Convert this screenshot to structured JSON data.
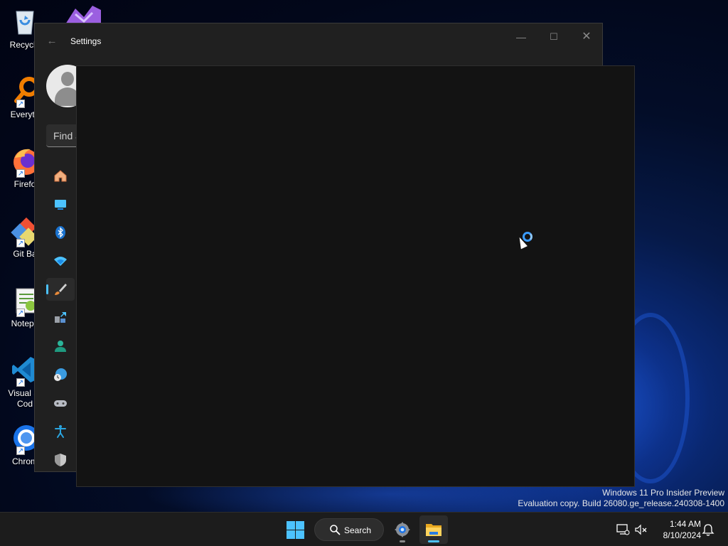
{
  "desktop": {
    "icons": [
      {
        "label": "Recycle",
        "icon": "recycle-bin-icon"
      },
      {
        "label": "Everyth",
        "icon": "everything-search-icon"
      },
      {
        "label": "Firefo",
        "icon": "firefox-icon"
      },
      {
        "label": "Git Ba",
        "icon": "git-bash-icon"
      },
      {
        "label": "Notepa",
        "icon": "notepad-plus-plus-icon"
      },
      {
        "label": "Visual St\nCod",
        "icon": "vscode-icon"
      },
      {
        "label": "Chrom",
        "icon": "chrome-icon"
      }
    ],
    "top_icon": "visual-studio-icon"
  },
  "settings_window": {
    "title": "Settings",
    "back_icon": "back-arrow-icon",
    "minimize_glyph": "—",
    "maximize_glyph": "☐",
    "close_glyph": "✕",
    "search_placeholder": "Find a setting",
    "nav_icons": [
      {
        "name": "home",
        "icon": "home-icon",
        "color": "#f0a060"
      },
      {
        "name": "system",
        "icon": "display-icon",
        "color": "#4cc2ff"
      },
      {
        "name": "bluetooth-devices",
        "icon": "bluetooth-icon",
        "color": "#1a8ce8"
      },
      {
        "name": "network-internet",
        "icon": "wifi-icon",
        "color": "#4cc2ff"
      },
      {
        "name": "personalization",
        "icon": "paintbrush-icon",
        "color": "#e88a3a",
        "selected": true
      },
      {
        "name": "apps",
        "icon": "apps-icon",
        "color": "#5aa0e0"
      },
      {
        "name": "accounts",
        "icon": "account-icon",
        "color": "#2bb59a"
      },
      {
        "name": "time-language",
        "icon": "time-language-icon",
        "color": "#3a9be0"
      },
      {
        "name": "gaming",
        "icon": "gamepad-icon",
        "color": "#b0b0b0"
      },
      {
        "name": "accessibility",
        "icon": "accessibility-icon",
        "color": "#2aa5e0"
      },
      {
        "name": "privacy-security",
        "icon": "shield-icon",
        "color": "#c0c0c0"
      }
    ]
  },
  "watermark": {
    "line1": "Windows 11 Pro Insider Preview",
    "line2": "Evaluation copy. Build 26080.ge_release.240308-1400"
  },
  "taskbar": {
    "search_label": "Search",
    "clock_time": "1:44 AM",
    "clock_date": "8/10/2024",
    "accent": "#4cc2ff"
  }
}
